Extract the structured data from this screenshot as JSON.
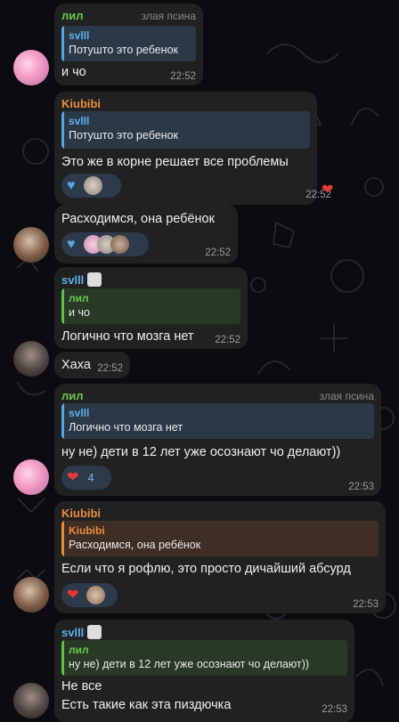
{
  "messages": [
    {
      "sender": "лил",
      "role": "злая псина",
      "quote_name": "svlll",
      "quote_text": "Потушто это ребенок",
      "text": "и чо",
      "time": "22:52"
    },
    {
      "sender": "Kiubibi",
      "quote_name": "svlll",
      "quote_text": "Потушто это ребенок",
      "text": "Это же в корне решает все проблемы",
      "time": "22:52"
    },
    {
      "text": "Расходимся, она ребёнок",
      "time": "22:52"
    },
    {
      "sender": "svlll",
      "quote_name": "лил",
      "quote_text": "и чо",
      "text": "Логично что мозга нет",
      "time": "22:52"
    },
    {
      "text": "Хаха",
      "time": "22:52"
    },
    {
      "sender": "лил",
      "role": "злая псина",
      "quote_name": "svlll",
      "quote_text": "Логично что мозга нет",
      "text": "ну не) дети в 12 лет уже осознают чо делают))",
      "reaction_count": "4",
      "time": "22:53"
    },
    {
      "sender": "Kiubibi",
      "quote_name": "Kiubibi",
      "quote_text": "Расходимся, она ребёнок",
      "text": "Если что я рофлю, это просто дичайший абсурд",
      "time": "22:53"
    },
    {
      "sender": "svlll",
      "quote_name": "лил",
      "quote_text": "ну не) дети в 12 лет уже осознают чо делают))",
      "text_line1": "Не все",
      "text_line2": "Есть такие как эта пиздючка",
      "time": "22:53"
    }
  ],
  "icons": {
    "heart": "❤",
    "blue_heart": "♥"
  },
  "colors": {
    "bubble": "#212121",
    "green_name": "#6cc84f",
    "orange_name": "#eb8d3d",
    "blue_name": "#5eb0ec",
    "reaction_bg": "#2c3a4a",
    "heart": "#e53935"
  }
}
